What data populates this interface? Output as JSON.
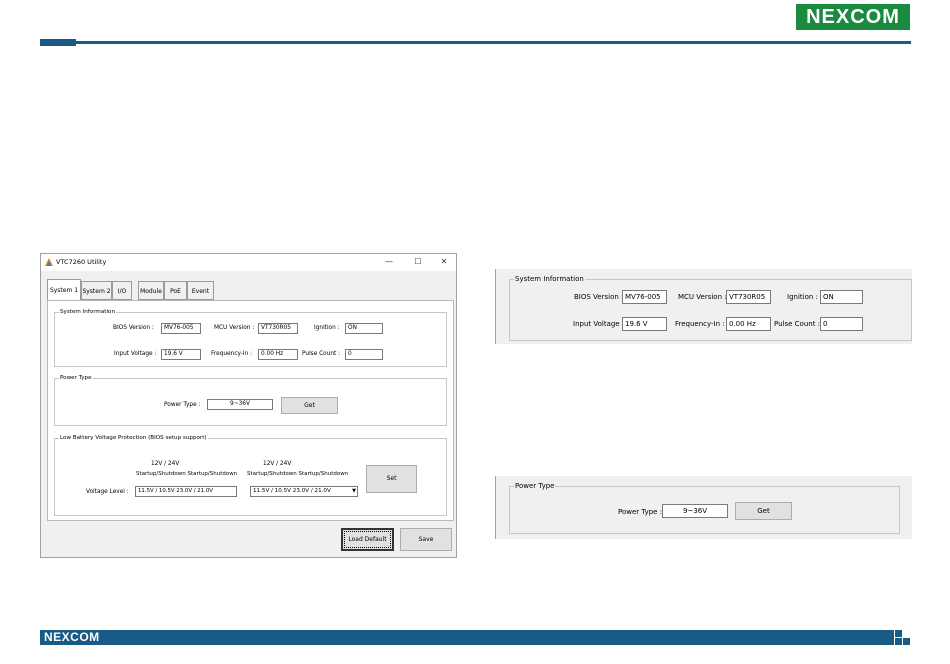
{
  "brand": {
    "logo_text": "NEXCOM",
    "footer_logo_text": "NEXCOM"
  },
  "window": {
    "title": "VTC7260 Utility",
    "controls": {
      "minimize": "—",
      "maximize": "☐",
      "close": "✕"
    },
    "tabs": [
      "System 1",
      "System 2",
      "I/O",
      "Module",
      "PoE",
      "Event"
    ],
    "active_tab": "System 1",
    "system_info": {
      "legend": "System Information",
      "bios_label": "BIOS Version :",
      "bios_value": "MV76-005",
      "mcu_label": "MCU Version :",
      "mcu_value": "VT730R05",
      "ignition_label": "Ignition :",
      "ignition_value": "ON",
      "input_voltage_label": "Input Voltage :",
      "input_voltage_value": "19.6 V",
      "frequency_label": "Frequency-In :",
      "frequency_value": "0.00 Hz",
      "pulse_label": "Pulse Count :",
      "pulse_value": "0"
    },
    "power_type": {
      "legend": "Power Type",
      "label": "Power Type :",
      "value": "9~36V",
      "get_button": "Get"
    },
    "low_battery": {
      "legend": "Low Battery Voltage Protection (BIOS setup support)",
      "col1_top": "12V          /          24V",
      "col1_bottom": "Startup/Shutdown Startup/Shutdown",
      "col2_top": "12V          /          24V",
      "col2_bottom": "Startup/Shutdown Startup/Shutdown",
      "voltage_label": "Voltage Level :",
      "field1": "11.5V / 10.5V     23.0V / 21.0V",
      "combo2": "11.5V / 10.5V     23.0V / 21.0V",
      "set_button": "Set"
    },
    "buttons": {
      "load_default": "Load Default",
      "save": "Save"
    }
  },
  "zoom_system_info": {
    "legend": "System Information",
    "bios_label": "BIOS Version :",
    "bios_value": "MV76-005",
    "mcu_label": "MCU Version :",
    "mcu_value": "VT730R05",
    "ignition_label": "Ignition :",
    "ignition_value": "ON",
    "input_voltage_label": "Input Voltage :",
    "input_voltage_value": "19.6 V",
    "frequency_label": "Frequency-In :",
    "frequency_value": "0.00 Hz",
    "pulse_label": "Pulse Count :",
    "pulse_value": "0"
  },
  "zoom_power_type": {
    "legend": "Power Type",
    "label": "Power Type :",
    "value": "9~36V",
    "get_button": "Get"
  }
}
